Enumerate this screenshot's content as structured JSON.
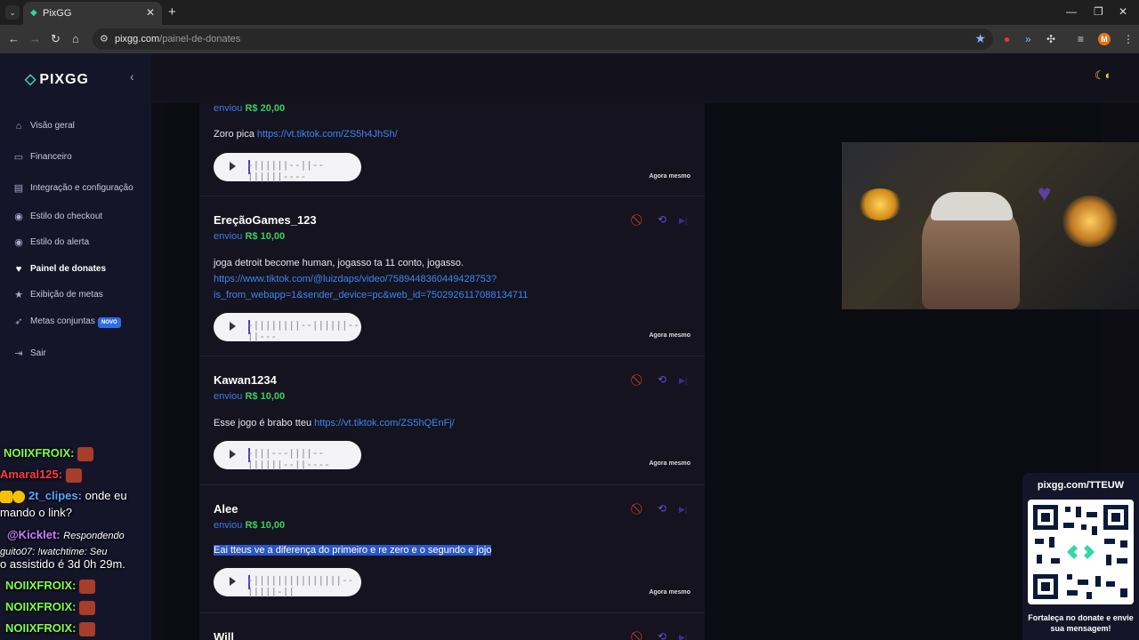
{
  "browser": {
    "tab_title": "PixGG",
    "url_host": "pixgg.com",
    "url_path": "/painel-de-donates"
  },
  "sidebar": {
    "logo": "PIXGG",
    "items": [
      {
        "label": "Visão geral",
        "icon": "home-icon"
      },
      {
        "label": "Financeiro",
        "icon": "wallet-icon"
      },
      {
        "label": "Integração e configuração",
        "icon": "integration-icon"
      },
      {
        "label": "Estilo do checkout",
        "icon": "palette-icon"
      },
      {
        "label": "Estilo do alerta",
        "icon": "palette-icon"
      },
      {
        "label": "Painel de donates",
        "icon": "donate-icon"
      },
      {
        "label": "Exibição de metas",
        "icon": "star-icon"
      },
      {
        "label": "Metas conjuntas",
        "icon": "rocket-icon",
        "badge": "NOVO"
      },
      {
        "label": "Sair",
        "icon": "logout-icon"
      }
    ]
  },
  "donations": [
    {
      "donor": "",
      "sent_label": "enviou",
      "amount": "R$ 20,00",
      "message": "Zoro pica ",
      "link": "https://vt.tiktok.com/ZS5h4JhSh/",
      "time": "Agora mesmo"
    },
    {
      "donor": "EreçãoGames_123",
      "sent_label": "enviou",
      "amount": "R$ 10,00",
      "message": "joga detroit become human, jogasso ta 11 conto, jogasso.",
      "link": "https://www.tiktok.com/@luizdaps/video/7589448360449428753?is_from_webapp=1&sender_device=pc&web_id=7502926117088134711",
      "link_line1": "https://www.tiktok.com/@luizdaps/video/7589448360449428753?",
      "link_line2": "is_from_webapp=1&sender_device=pc&web_id=7502926117088134711",
      "time": "Agora mesmo"
    },
    {
      "donor": "Kawan1234",
      "sent_label": "enviou",
      "amount": "R$ 10,00",
      "message": "Esse jogo é brabo tteu ",
      "link": "https://vt.tiktok.com/ZS5hQEnFj/",
      "time": "Agora mesmo"
    },
    {
      "donor": "Alee",
      "sent_label": "enviou",
      "amount": "R$ 10,00",
      "message": "Eai tteus ve a diferença do primeiro e re zero e o segundo e jojo",
      "time": "Agora mesmo"
    },
    {
      "donor": "Will"
    }
  ],
  "waveforms": [
    "-||||||--||--||||||----",
    "-||||||||--||||||--||---",
    "-|||---||||--||||||--||----",
    "-|||||||||||||||--|||||-||"
  ],
  "chat": [
    {
      "user": "NOIIXFROIX:",
      "message": ""
    },
    {
      "user": "Amaral125:",
      "message": ""
    },
    {
      "user": "2t_clipes:",
      "message": "onde eu"
    },
    {
      "user": "",
      "message": "mando o link?"
    },
    {
      "user": "@Kicklet:",
      "message": "Respondendo"
    },
    {
      "user": "",
      "message": "guito07: !watchtime: Seu"
    },
    {
      "user": "",
      "message": "o assistido é 3d 0h 29m."
    },
    {
      "user": "NOIIXFROIX:",
      "message": ""
    },
    {
      "user": "NOIIXFROIX:",
      "message": ""
    },
    {
      "user": "NOIIXFROIX:",
      "message": ""
    }
  ],
  "qr_panel": {
    "url": "pixgg.com/TTEUW",
    "footer": "Fortaleça no donate e envie sua mensagem!"
  },
  "colors": {
    "accent": "#35d6a8",
    "amount_green": "#34d35d",
    "link_blue": "#3e86f0",
    "ban_red": "#e03a3a"
  }
}
